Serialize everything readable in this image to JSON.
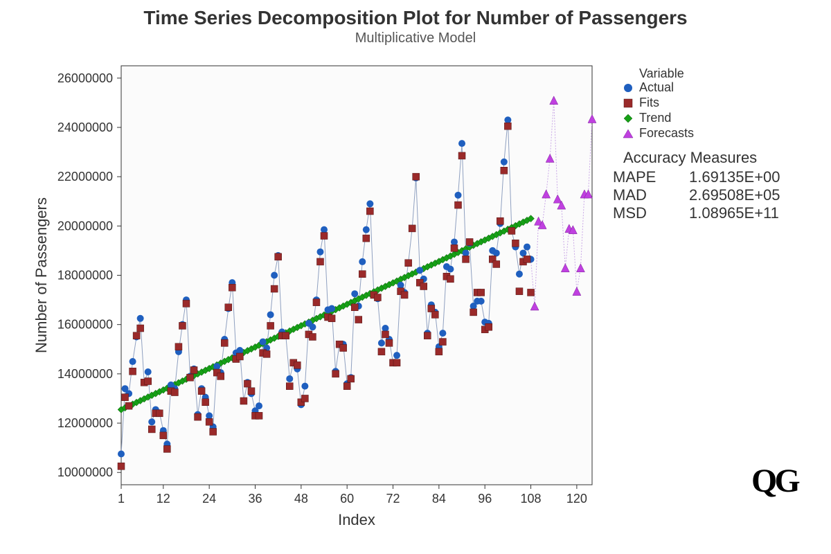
{
  "title": "Time Series Decomposition Plot for Number of Passengers",
  "subtitle": "Multiplicative Model",
  "xlabel": "Index",
  "ylabel": "Number of Passengers",
  "legend": {
    "title": "Variable",
    "items": [
      "Actual",
      "Fits",
      "Trend",
      "Forecasts"
    ]
  },
  "accuracy": {
    "title": "Accuracy Measures",
    "rows": [
      {
        "label": "MAPE",
        "value": "1.69135E+00"
      },
      {
        "label": "MAD",
        "value": "2.69508E+05"
      },
      {
        "label": "MSD",
        "value": "1.08965E+11"
      }
    ]
  },
  "logo": "QG",
  "chart_data": {
    "type": "scatter",
    "xlabel": "Index",
    "ylabel": "Number of Passengers",
    "xlim": [
      1,
      124
    ],
    "ylim": [
      9500000,
      26500000
    ],
    "x_ticks": [
      1,
      12,
      24,
      36,
      48,
      60,
      72,
      84,
      96,
      108,
      120
    ],
    "y_ticks": [
      10000000,
      12000000,
      14000000,
      16000000,
      18000000,
      20000000,
      22000000,
      24000000,
      26000000
    ],
    "trend": {
      "x0": 1,
      "y0": 12550000,
      "x1": 108,
      "y1": 20300000
    },
    "series": [
      {
        "name": "Actual",
        "shape": "circle",
        "color": "#1f5fbf",
        "points": [
          [
            1,
            10750000
          ],
          [
            2,
            13400000
          ],
          [
            3,
            13200000
          ],
          [
            4,
            14500000
          ],
          [
            5,
            15500000
          ],
          [
            6,
            16250000
          ],
          [
            7,
            13650000
          ],
          [
            8,
            14080000
          ],
          [
            9,
            12050000
          ],
          [
            10,
            12550000
          ],
          [
            11,
            12420000
          ],
          [
            12,
            11700000
          ],
          [
            13,
            11150000
          ],
          [
            14,
            13550000
          ],
          [
            15,
            13400000
          ],
          [
            16,
            14900000
          ],
          [
            17,
            16000000
          ],
          [
            18,
            17000000
          ],
          [
            19,
            13900000
          ],
          [
            20,
            14200000
          ],
          [
            21,
            12350000
          ],
          [
            22,
            13400000
          ],
          [
            23,
            13050000
          ],
          [
            24,
            12300000
          ],
          [
            25,
            11850000
          ],
          [
            26,
            14300000
          ],
          [
            27,
            14050000
          ],
          [
            28,
            15400000
          ],
          [
            29,
            16650000
          ],
          [
            30,
            17700000
          ],
          [
            31,
            14850000
          ],
          [
            32,
            14950000
          ],
          [
            33,
            12900000
          ],
          [
            34,
            13650000
          ],
          [
            35,
            13200000
          ],
          [
            36,
            12500000
          ],
          [
            37,
            12700000
          ],
          [
            38,
            15300000
          ],
          [
            39,
            15050000
          ],
          [
            40,
            16400000
          ],
          [
            41,
            18000000
          ],
          [
            42,
            18800000
          ],
          [
            43,
            15700000
          ],
          [
            44,
            15550000
          ],
          [
            45,
            13800000
          ],
          [
            46,
            14450000
          ],
          [
            47,
            14200000
          ],
          [
            48,
            12750000
          ],
          [
            49,
            13500000
          ],
          [
            50,
            16050000
          ],
          [
            51,
            15900000
          ],
          [
            52,
            17000000
          ],
          [
            53,
            18950000
          ],
          [
            54,
            19850000
          ],
          [
            55,
            16600000
          ],
          [
            56,
            16650000
          ],
          [
            57,
            14100000
          ],
          [
            58,
            15200000
          ],
          [
            59,
            15200000
          ],
          [
            60,
            13600000
          ],
          [
            61,
            13850000
          ],
          [
            62,
            17250000
          ],
          [
            63,
            16750000
          ],
          [
            64,
            18550000
          ],
          [
            65,
            19850000
          ],
          [
            66,
            20900000
          ],
          [
            67,
            17200000
          ],
          [
            68,
            17050000
          ],
          [
            69,
            15250000
          ],
          [
            70,
            15850000
          ],
          [
            71,
            15400000
          ],
          [
            72,
            14450000
          ],
          [
            73,
            14750000
          ],
          [
            74,
            17600000
          ],
          [
            75,
            17300000
          ],
          [
            76,
            18500000
          ],
          [
            77,
            19900000
          ],
          [
            78,
            21950000
          ],
          [
            79,
            18200000
          ],
          [
            80,
            17850000
          ],
          [
            81,
            15650000
          ],
          [
            82,
            16800000
          ],
          [
            83,
            16500000
          ],
          [
            84,
            15100000
          ],
          [
            85,
            15650000
          ],
          [
            86,
            18350000
          ],
          [
            87,
            18250000
          ],
          [
            88,
            19350000
          ],
          [
            89,
            21250000
          ],
          [
            90,
            23350000
          ],
          [
            91,
            18900000
          ],
          [
            92,
            19300000
          ],
          [
            93,
            16750000
          ],
          [
            94,
            16950000
          ],
          [
            95,
            16950000
          ],
          [
            96,
            16100000
          ],
          [
            97,
            16050000
          ],
          [
            98,
            19000000
          ],
          [
            99,
            18900000
          ],
          [
            100,
            20100000
          ],
          [
            101,
            22600000
          ],
          [
            102,
            24300000
          ],
          [
            103,
            19800000
          ],
          [
            104,
            19150000
          ],
          [
            105,
            18050000
          ],
          [
            106,
            18900000
          ],
          [
            107,
            19150000
          ],
          [
            108,
            18650000
          ]
        ]
      },
      {
        "name": "Fits",
        "shape": "square",
        "color": "#9a2a2a",
        "points": [
          [
            1,
            10250000
          ],
          [
            2,
            13050000
          ],
          [
            3,
            12700000
          ],
          [
            4,
            14100000
          ],
          [
            5,
            15550000
          ],
          [
            6,
            15850000
          ],
          [
            7,
            13650000
          ],
          [
            8,
            13700000
          ],
          [
            9,
            11750000
          ],
          [
            10,
            12400000
          ],
          [
            11,
            12400000
          ],
          [
            12,
            11500000
          ],
          [
            13,
            10950000
          ],
          [
            14,
            13300000
          ],
          [
            15,
            13250000
          ],
          [
            16,
            15100000
          ],
          [
            17,
            15950000
          ],
          [
            18,
            16850000
          ],
          [
            19,
            13850000
          ],
          [
            20,
            14150000
          ],
          [
            21,
            12250000
          ],
          [
            22,
            13300000
          ],
          [
            23,
            12850000
          ],
          [
            24,
            12050000
          ],
          [
            25,
            11650000
          ],
          [
            26,
            14050000
          ],
          [
            27,
            13900000
          ],
          [
            28,
            15250000
          ],
          [
            29,
            16700000
          ],
          [
            30,
            17500000
          ],
          [
            31,
            14600000
          ],
          [
            32,
            14700000
          ],
          [
            33,
            12900000
          ],
          [
            34,
            13600000
          ],
          [
            35,
            13300000
          ],
          [
            36,
            12300000
          ],
          [
            37,
            12300000
          ],
          [
            38,
            14850000
          ],
          [
            39,
            14800000
          ],
          [
            40,
            15950000
          ],
          [
            41,
            17450000
          ],
          [
            42,
            18750000
          ],
          [
            43,
            15550000
          ],
          [
            44,
            15550000
          ],
          [
            45,
            13500000
          ],
          [
            46,
            14450000
          ],
          [
            47,
            14350000
          ],
          [
            48,
            12850000
          ],
          [
            49,
            13000000
          ],
          [
            50,
            15600000
          ],
          [
            51,
            15500000
          ],
          [
            52,
            16900000
          ],
          [
            53,
            18550000
          ],
          [
            54,
            19600000
          ],
          [
            55,
            16300000
          ],
          [
            56,
            16250000
          ],
          [
            57,
            14000000
          ],
          [
            58,
            15200000
          ],
          [
            59,
            15050000
          ],
          [
            60,
            13500000
          ],
          [
            61,
            13800000
          ],
          [
            62,
            16700000
          ],
          [
            63,
            16200000
          ],
          [
            64,
            18050000
          ],
          [
            65,
            19500000
          ],
          [
            66,
            20600000
          ],
          [
            67,
            17200000
          ],
          [
            68,
            17100000
          ],
          [
            69,
            14900000
          ],
          [
            70,
            15600000
          ],
          [
            71,
            15250000
          ],
          [
            72,
            14450000
          ],
          [
            73,
            14450000
          ],
          [
            74,
            17350000
          ],
          [
            75,
            17200000
          ],
          [
            76,
            18500000
          ],
          [
            77,
            19900000
          ],
          [
            78,
            22000000
          ],
          [
            79,
            17700000
          ],
          [
            80,
            17550000
          ],
          [
            81,
            15550000
          ],
          [
            82,
            16650000
          ],
          [
            83,
            16400000
          ],
          [
            84,
            14900000
          ],
          [
            85,
            15300000
          ],
          [
            86,
            17950000
          ],
          [
            87,
            17850000
          ],
          [
            88,
            19100000
          ],
          [
            89,
            20850000
          ],
          [
            90,
            22850000
          ],
          [
            91,
            18650000
          ],
          [
            92,
            19350000
          ],
          [
            93,
            16500000
          ],
          [
            94,
            17300000
          ],
          [
            95,
            17300000
          ],
          [
            96,
            15800000
          ],
          [
            97,
            15900000
          ],
          [
            98,
            18650000
          ],
          [
            99,
            18450000
          ],
          [
            100,
            20200000
          ],
          [
            101,
            22250000
          ],
          [
            102,
            24050000
          ],
          [
            103,
            19800000
          ],
          [
            104,
            19300000
          ],
          [
            105,
            17350000
          ],
          [
            106,
            18550000
          ],
          [
            107,
            18650000
          ],
          [
            108,
            17300000
          ]
        ]
      },
      {
        "name": "Forecasts",
        "shape": "triangle",
        "color": "#c040e0",
        "points": [
          [
            109,
            16750000
          ],
          [
            110,
            20200000
          ],
          [
            111,
            20050000
          ],
          [
            112,
            21300000
          ],
          [
            113,
            22750000
          ],
          [
            114,
            25100000
          ],
          [
            115,
            21100000
          ],
          [
            116,
            20850000
          ],
          [
            117,
            18300000
          ],
          [
            118,
            19900000
          ],
          [
            119,
            19850000
          ],
          [
            120,
            17350000
          ],
          [
            121,
            18300000
          ],
          [
            122,
            21300000
          ],
          [
            123,
            21300000
          ],
          [
            124,
            24350000
          ]
        ]
      }
    ]
  }
}
